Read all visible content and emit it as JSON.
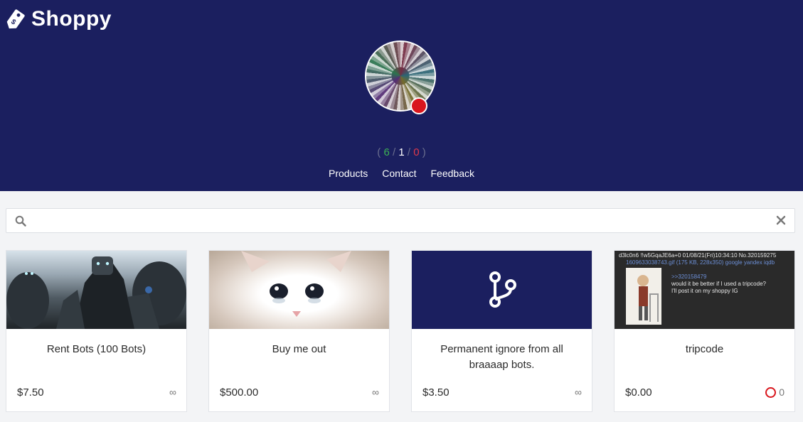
{
  "brand": {
    "name": "Shoppy"
  },
  "profile": {
    "stats": {
      "open": "(",
      "positive": "6",
      "sep1": "/",
      "neutral": "1",
      "sep2": "/",
      "negative": "0",
      "close": ")"
    }
  },
  "nav": {
    "products": "Products",
    "contact": "Contact",
    "feedback": "Feedback"
  },
  "search": {
    "placeholder": "",
    "value": ""
  },
  "colors": {
    "header_bg": "#1b1f5f",
    "positive": "#3cb054",
    "negative": "#e0384a",
    "status_dot": "#d9161d"
  },
  "products": [
    {
      "title": "Rent Bots (100 Bots)",
      "price": "$7.50",
      "stock": "∞"
    },
    {
      "title": "Buy me out",
      "price": "$500.00",
      "stock": "∞"
    },
    {
      "title": "Permanent ignore from all braaaap bots.",
      "price": "$3.50",
      "stock": "∞",
      "icon": "git-branch-icon"
    },
    {
      "title": "tripcode",
      "price": "$0.00",
      "stock": "0",
      "stock_icon": "out-of-stock-ring-icon"
    }
  ],
  "post_screenshot": {
    "header": "d3lc0n6 !!w5GqaJE6a+0 01/08/21(Fri)10:34:10 No.320159275",
    "file": "1609633038743.gif (175 KB, 228x350) google yandex iqdb",
    "reply": ">>320158479",
    "line1": "would it be better if I used a tripcode?",
    "line2": "I'll post it on my shoppy IG"
  }
}
